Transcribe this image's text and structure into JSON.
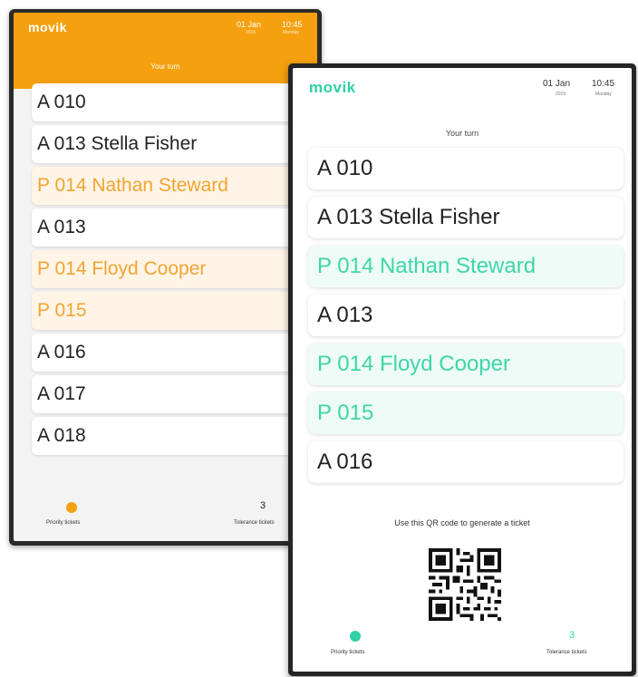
{
  "back_display": {
    "logo": "movik",
    "date": "01 Jan",
    "date_sub": "2015",
    "time": "10:45",
    "time_sub": "Monday",
    "turn_label": "Your turn",
    "accent_color": "#f5a00f",
    "tickets": [
      {
        "label": "A 010",
        "priority": false
      },
      {
        "label": "A 013 Stella Fisher",
        "priority": false
      },
      {
        "label": "P 014 Nathan Steward",
        "priority": true
      },
      {
        "label": "A 013",
        "priority": false
      },
      {
        "label": "P 014 Floyd Cooper",
        "priority": true
      },
      {
        "label": "P 015",
        "priority": true
      },
      {
        "label": "A 016",
        "priority": false
      },
      {
        "label": "A 017",
        "priority": false
      },
      {
        "label": "A 018",
        "priority": false
      }
    ],
    "priority_label": "Priority tickets",
    "tolerance_count": "3",
    "tolerance_label": "Tolerance tickets"
  },
  "front_display": {
    "logo": "movik",
    "date": "01 Jan",
    "date_sub": "2015",
    "time": "10:45",
    "time_sub": "Monday",
    "turn_label": "Your turn",
    "accent_color": "#2fd1a6",
    "tickets": [
      {
        "label": "A 010",
        "priority": false
      },
      {
        "label": "A 013 Stella Fisher",
        "priority": false
      },
      {
        "label": "P 014 Nathan Steward",
        "priority": true
      },
      {
        "label": "A 013",
        "priority": false
      },
      {
        "label": "P 014 Floyd Cooper",
        "priority": true
      },
      {
        "label": "P 015",
        "priority": true
      },
      {
        "label": "A 016",
        "priority": false
      }
    ],
    "qr_caption": "Use this QR code to generate a ticket",
    "priority_label": "Priority tickets",
    "tolerance_count": "3",
    "tolerance_label": "Tolerance tickets"
  }
}
